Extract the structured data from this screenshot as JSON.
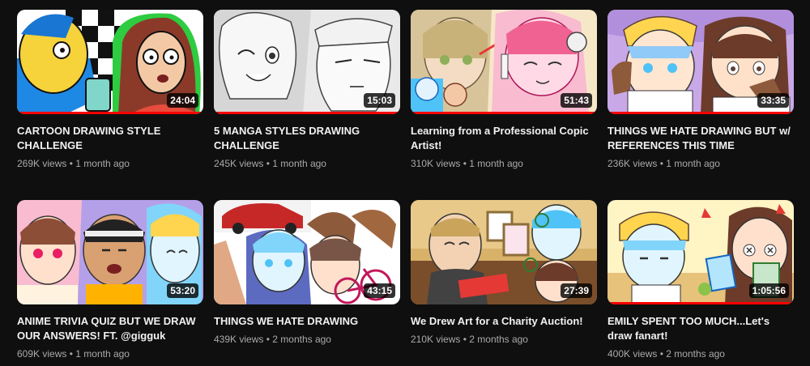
{
  "videos": [
    {
      "title": "CARTOON DRAWING STYLE CHALLENGE",
      "duration": "24:04",
      "views": "269K views",
      "age": "1 month ago",
      "watched": 1.0
    },
    {
      "title": "5 MANGA STYLES DRAWING CHALLENGE",
      "duration": "15:03",
      "views": "245K views",
      "age": "1 month ago",
      "watched": 1.0
    },
    {
      "title": "Learning from a Professional Copic Artist!",
      "duration": "51:43",
      "views": "310K views",
      "age": "1 month ago",
      "watched": 1.0
    },
    {
      "title": "THINGS WE HATE DRAWING BUT w/ REFERENCES THIS TIME",
      "duration": "33:35",
      "views": "236K views",
      "age": "1 month ago",
      "watched": 1.0
    },
    {
      "title": "ANIME TRIVIA QUIZ BUT WE DRAW OUR ANSWERS! FT. @gigguk",
      "duration": "53:20",
      "views": "609K views",
      "age": "1 month ago",
      "watched": 0.0
    },
    {
      "title": "THINGS WE HATE DRAWING",
      "duration": "43:15",
      "views": "439K views",
      "age": "2 months ago",
      "watched": 0.0
    },
    {
      "title": "We Drew Art for a Charity Auction!",
      "duration": "27:39",
      "views": "210K views",
      "age": "2 months ago",
      "watched": 0.0
    },
    {
      "title": "EMILY SPENT TOO MUCH...Let's draw fanart!",
      "duration": "1:05:56",
      "views": "400K views",
      "age": "2 months ago",
      "watched": 1.0
    }
  ],
  "separator": "•"
}
